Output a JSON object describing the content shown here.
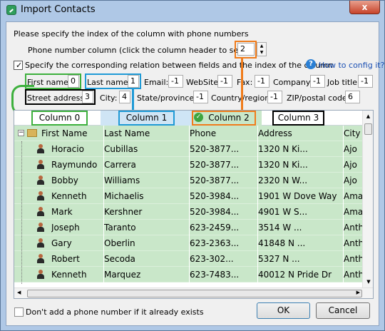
{
  "window": {
    "title": "Import Contacts",
    "close_label": "x"
  },
  "instruction": "Please specify the index of the column with phone numbers",
  "phone_column": {
    "label": "Phone number column (click the column header to select it):",
    "value": "2"
  },
  "specify": {
    "label": "Specify the corresponding relation between fields and the index of the column",
    "help": "How to config it?"
  },
  "fields": [
    {
      "label": "First name:",
      "value": "0"
    },
    {
      "label": "Last name:",
      "value": "1"
    },
    {
      "label": "Email:",
      "value": "-1"
    },
    {
      "label": "WebSite:",
      "value": "-1"
    },
    {
      "label": "Fax:",
      "value": "-1"
    },
    {
      "label": "Company:",
      "value": "-1"
    },
    {
      "label": "Job title:",
      "value": "-1"
    },
    {
      "label": "Street address:",
      "value": "3"
    },
    {
      "label": "City:",
      "value": "4"
    },
    {
      "label": "State/province:",
      "value": "-1"
    },
    {
      "label": "Country/region:",
      "value": "-1"
    },
    {
      "label": "ZIP/postal code:",
      "value": "6"
    }
  ],
  "column_labels": [
    "Column 0",
    "Column 1",
    "Column 2",
    "Column 3"
  ],
  "grid": {
    "headers": [
      "First Name",
      "Last Name",
      "Phone",
      "Address",
      "City"
    ],
    "rows": [
      [
        "Horacio",
        "Cubillas",
        "520-3877...",
        "1320 N Ki...",
        "Ajo"
      ],
      [
        "Raymundo",
        "Carrera",
        "520-3877...",
        "1320 N Ki...",
        "Ajo"
      ],
      [
        "Bobby",
        "Williams",
        "520-3877...",
        "2320 N W...",
        "Ajo"
      ],
      [
        "Kenneth",
        "Michaelis",
        "520-3984...",
        "1901 W Dove Way",
        "Ama"
      ],
      [
        "Mark",
        "Kershner",
        "520-3984...",
        "4901 W S...",
        "Ama"
      ],
      [
        "Joseph",
        "Taranto",
        "623-2459...",
        "3514 W ...",
        "Anth"
      ],
      [
        "Gary",
        "Oberlin",
        "623-2363...",
        "41848 N ...",
        "Anth"
      ],
      [
        "Robert",
        "Secoda",
        "623-302...",
        "5327 N ...",
        "Anth"
      ],
      [
        "Kenneth",
        "Marquez",
        "623-7483...",
        "40012 N Pride Dr",
        "Anth"
      ]
    ]
  },
  "footer": {
    "dont_add_label": "Don't add a phone number if it already exists",
    "ok": "OK",
    "cancel": "Cancel"
  },
  "colors": {
    "accent_green": "#3db03d",
    "accent_blue": "#1f9ad6",
    "accent_orange": "#f07c1b",
    "annotation_black": "#000000",
    "row_green": "#c9e7c9"
  }
}
